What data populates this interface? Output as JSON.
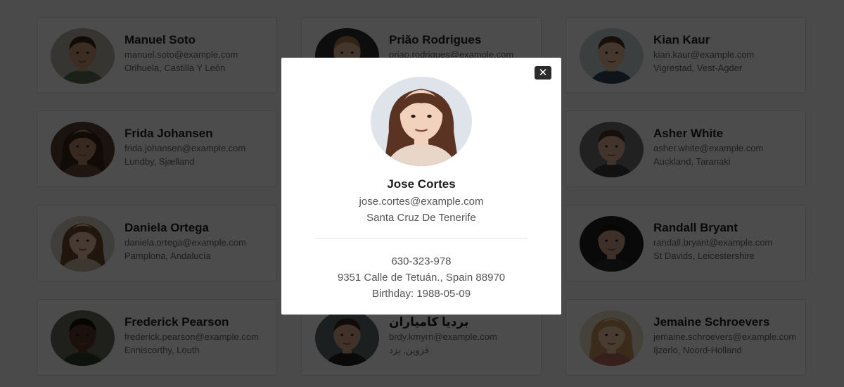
{
  "users": [
    {
      "name": "Manuel Soto",
      "email": "manuel.soto@example.com",
      "location": "Orihuela, Castilla Y León",
      "skin": "#c99873",
      "hair": "#3d2b1f",
      "bg": "#b7b3a6",
      "shirt": "#5b6b54"
    },
    {
      "name": "Prião Rodrigues",
      "email": "priao.rodrigues@example.com",
      "location": "",
      "skin": "#e0b494",
      "hair": "#a47a48",
      "bg": "#2e2e2e",
      "shirt": "#222222"
    },
    {
      "name": "Kian Kaur",
      "email": "kian.kaur@example.com",
      "location": "Vigrestad, Vest-Agder",
      "skin": "#e4b89a",
      "hair": "#4a3424",
      "bg": "#c9d3d8",
      "shirt": "#33455c"
    },
    {
      "name": "Frida Johansen",
      "email": "frida.johansen@example.com",
      "location": "Lundby, Sjælland",
      "skin": "#b98a6a",
      "hair": "#3a2518",
      "bg": "#5a4238",
      "shirt": "#6b4a3b"
    },
    {
      "name": "Asher White",
      "email": "asher.white@example.com",
      "location": "Auckland, Taranaki",
      "skin": "#d9b096",
      "hair": "#4a3323",
      "bg": "#6e6e6e",
      "shirt": "#3a3a3a"
    },
    {
      "name": "Daniela Ortega",
      "email": "daniela.ortega@example.com",
      "location": "Pamplona, Andalucía",
      "skin": "#ecc4a7",
      "hair": "#6e4a30",
      "bg": "#d8d0c6",
      "shirt": "#c9b8a6"
    },
    {
      "name": "Randall Bryant",
      "email": "randall.bryant@example.com",
      "location": "St Davids, Leicestershire",
      "skin": "#caa086",
      "hair": "#1f1a17",
      "bg": "#1e1e1e",
      "shirt": "#2a2a2a"
    },
    {
      "name": "Frederick Pearson",
      "email": "frederick.pearson@example.com",
      "location": "Enniscorthy, Louth",
      "skin": "#5a3a28",
      "hair": "#1a1210",
      "bg": "#6a6a5a",
      "shirt": "#2f3e2c"
    },
    {
      "name": "بردیا کامیاران",
      "email": "brdy.kmyrn@example.com",
      "location": "قزوین, یزد",
      "skin": "#d7a88a",
      "hair": "#3a2a20",
      "bg": "#5f6a6a",
      "shirt": "#1f1f1f"
    },
    {
      "name": "Jemaine Schroevers",
      "email": "jemaine.schroevers@example.com",
      "location": "Ijzerlo, Noord-Holland",
      "skin": "#f0c9a6",
      "hair": "#c4905a",
      "bg": "#e8ddc6",
      "shirt": "#b86a5a"
    }
  ],
  "modal": {
    "name": "Jose Cortes",
    "email": "jose.cortes@example.com",
    "location": "Santa Cruz De Tenerife",
    "phone": "630-323-978",
    "address": "9351 Calle de Tetuán., Spain 88970",
    "birthday": "Birthday: 1988-05-09",
    "close_label": "✕",
    "skin": "#f2d2bd",
    "hair": "#5a3322",
    "bg": "#dfe4ea",
    "close_icon": "close-icon"
  }
}
